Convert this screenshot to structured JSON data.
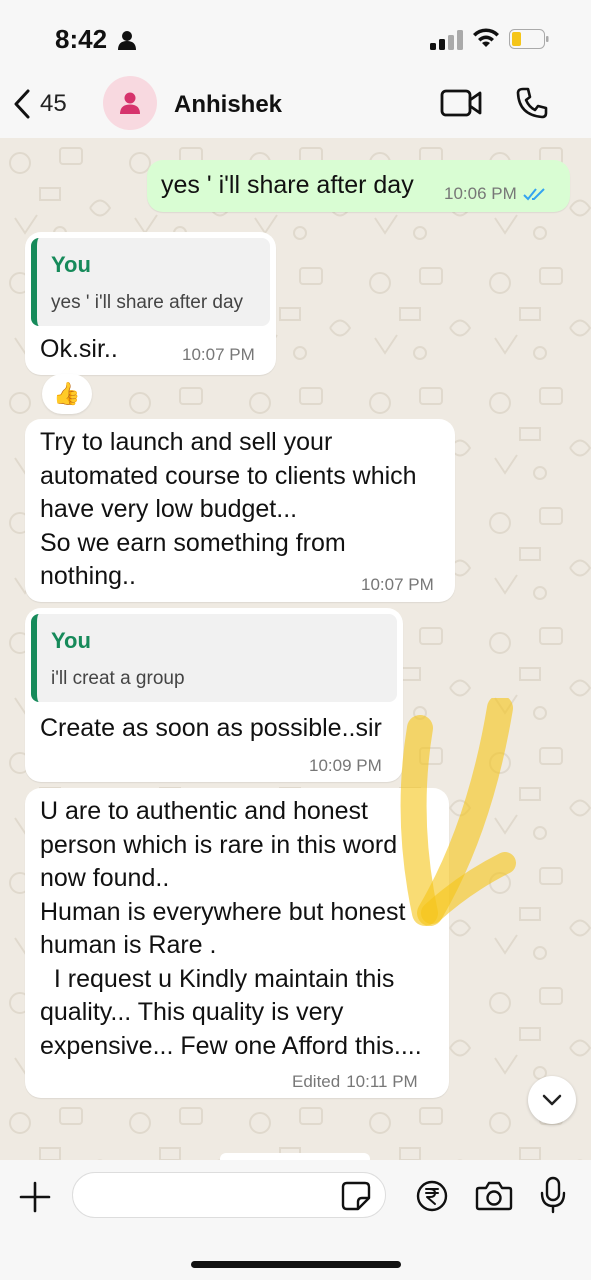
{
  "status_bar": {
    "time": "8:42"
  },
  "header": {
    "back_count": "45",
    "contact_name": "Anhishek"
  },
  "messages": [
    {
      "direction": "out",
      "text": "yes ' i'll share after day",
      "time": "10:06 PM",
      "status_icon": "double-check-read"
    },
    {
      "direction": "in",
      "quote_author": "You",
      "quote_text": "yes ' i'll share after day",
      "text": "Ok.sir..",
      "time": "10:07 PM",
      "reaction": "👍"
    },
    {
      "direction": "in",
      "text": "Try to launch and sell your\nautomated course to clients which\nhave very low budget...\nSo we earn something from\nnothing..",
      "time": "10:07 PM"
    },
    {
      "direction": "in",
      "quote_author": "You",
      "quote_text": "i'll creat a group",
      "text": "Create as soon as possible..sir",
      "time": "10:09 PM"
    },
    {
      "direction": "in",
      "text": "U are to authentic and honest\nperson which is rare in this word\nnow found..\nHuman is everywhere but honest\nhuman is Rare .\n  I request u Kindly maintain this\nquality... This quality is very\nexpensive... Few one Afford this....",
      "edited_label": "Edited",
      "time": "10:11 PM"
    }
  ],
  "colors": {
    "outgoing_bubble": "#d9fdd3",
    "incoming_bubble": "#ffffff",
    "quote_accent": "#168a5a",
    "read_ticks": "#34a3f0",
    "highlight": "#f5c518",
    "avatar_bg": "#f8d9e0",
    "avatar_icon": "#d6336c"
  }
}
